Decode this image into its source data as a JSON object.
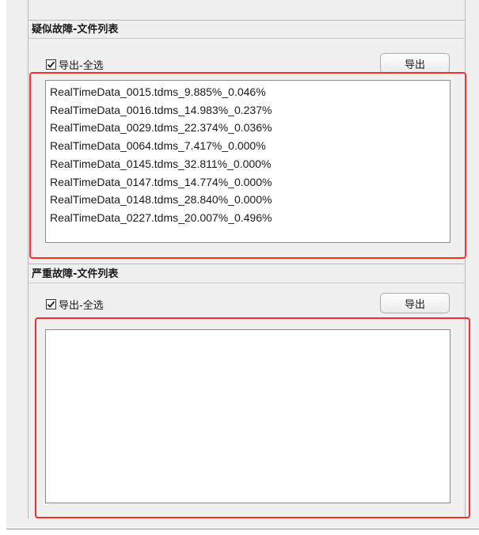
{
  "panel1": {
    "title": "疑似故障-文件列表",
    "select_all_label": "导出-全选",
    "select_all_checked": true,
    "export_button_label": "导出",
    "files": [
      "RealTimeData_0015.tdms_9.885%_0.046%",
      "RealTimeData_0016.tdms_14.983%_0.237%",
      "RealTimeData_0029.tdms_22.374%_0.036%",
      "RealTimeData_0064.tdms_7.417%_0.000%",
      "RealTimeData_0145.tdms_32.811%_0.000%",
      "RealTimeData_0147.tdms_14.774%_0.000%",
      "RealTimeData_0148.tdms_28.840%_0.000%",
      "RealTimeData_0227.tdms_20.007%_0.496%"
    ]
  },
  "panel2": {
    "title": "严重故障-文件列表",
    "select_all_label": "导出-全选",
    "select_all_checked": true,
    "export_button_label": "导出",
    "files": []
  },
  "colors": {
    "highlight": "#ff2a2a",
    "panel_background": "#f0f0f0",
    "list_background": "#ffffff"
  }
}
